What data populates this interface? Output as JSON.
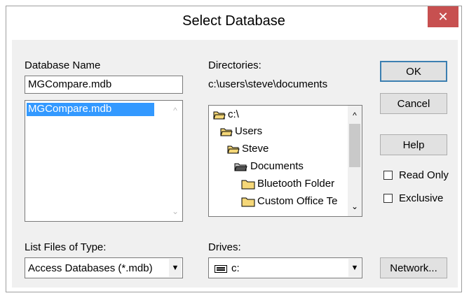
{
  "window": {
    "title": "Select Database",
    "close_glyph": "✕"
  },
  "database_name": {
    "label": "Database Name",
    "value": "MGCompare.mdb",
    "files": [
      "MGCompare.mdb"
    ]
  },
  "directories": {
    "label": "Directories:",
    "current_path": "c:\\users\\steve\\documents",
    "items": [
      "c:\\",
      "Users",
      "Steve",
      "Documents",
      "Bluetooth Folder",
      "Custom Office Te"
    ]
  },
  "buttons": {
    "ok": "OK",
    "cancel": "Cancel",
    "help": "Help",
    "network": "Network..."
  },
  "options": {
    "read_only": "Read Only",
    "exclusive": "Exclusive"
  },
  "file_type": {
    "label": "List Files of Type:",
    "selected": "Access Databases (*.mdb)"
  },
  "drives": {
    "label": "Drives:",
    "selected": "c:"
  },
  "colors": {
    "selection": "#3399ff",
    "folder": "#f5d778",
    "close": "#c75050",
    "default_border": "#3c7fb1"
  }
}
